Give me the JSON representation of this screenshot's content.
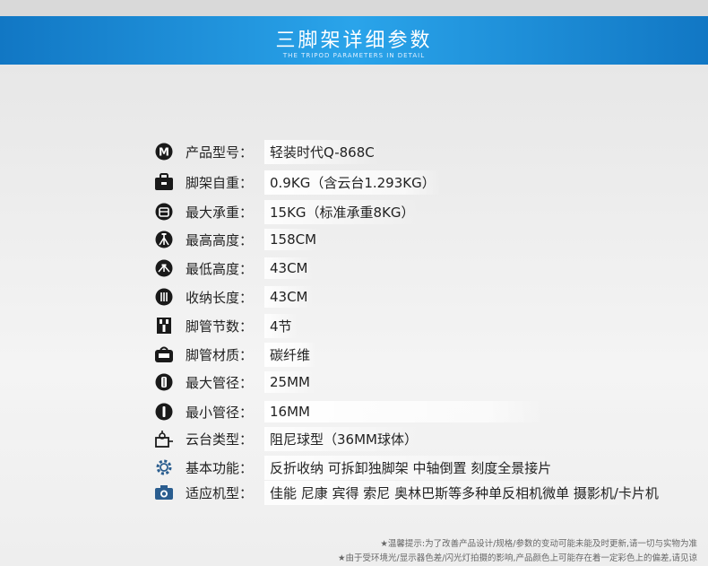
{
  "header": {
    "title": "三脚架详细参数",
    "subtitle": "THE TRIPOD PARAMETERS IN DETAIL"
  },
  "specs": [
    {
      "icon": "m-badge-icon",
      "label": "产品型号：",
      "value": "轻装时代Q-868C"
    },
    {
      "icon": "bag-icon",
      "label": "脚架自重：",
      "value": "0.9KG（含云台1.293KG）"
    },
    {
      "icon": "weight-icon",
      "label": "最大承重：",
      "value": "15KG（标准承重8KG）"
    },
    {
      "icon": "tripod-tall-icon",
      "label": "最高高度：",
      "value": "158CM"
    },
    {
      "icon": "tripod-low-icon",
      "label": "最低高度：",
      "value": "43CM"
    },
    {
      "icon": "tripod-folded-icon",
      "label": "收纳长度：",
      "value": "43CM"
    },
    {
      "icon": "tube-sections-icon",
      "label": "脚管节数：",
      "value": "4节"
    },
    {
      "icon": "material-icon",
      "label": "脚管材质：",
      "value": "碳纤维"
    },
    {
      "icon": "tube-large-icon",
      "label": "最大管径：",
      "value": "25MM"
    },
    {
      "icon": "tube-small-icon",
      "label": "最小管径：",
      "value": "16MM"
    },
    {
      "icon": "ballhead-icon",
      "label": "云台类型：",
      "value": "阻尼球型（36MM球体）"
    },
    {
      "icon": "gear-icon",
      "label": "基本功能：",
      "value": "反折收纳  可拆卸独脚架  中轴倒置  刻度全景接片"
    },
    {
      "icon": "camera-icon",
      "label": "适应机型：",
      "value": "佳能 尼康  宾得  索尼  奥林巴斯等多种单反相机微单  摄影机/卡片机"
    }
  ],
  "footnotes": [
    "★温馨提示:为了改善产品设计/规格/参数的变动可能未能及时更新,请一切与实物为准",
    "★由于受环境光/显示器色差/闪光灯拍摄的影响,产品颜色上可能存在着一定彩色上的偏差,请见谅"
  ]
}
